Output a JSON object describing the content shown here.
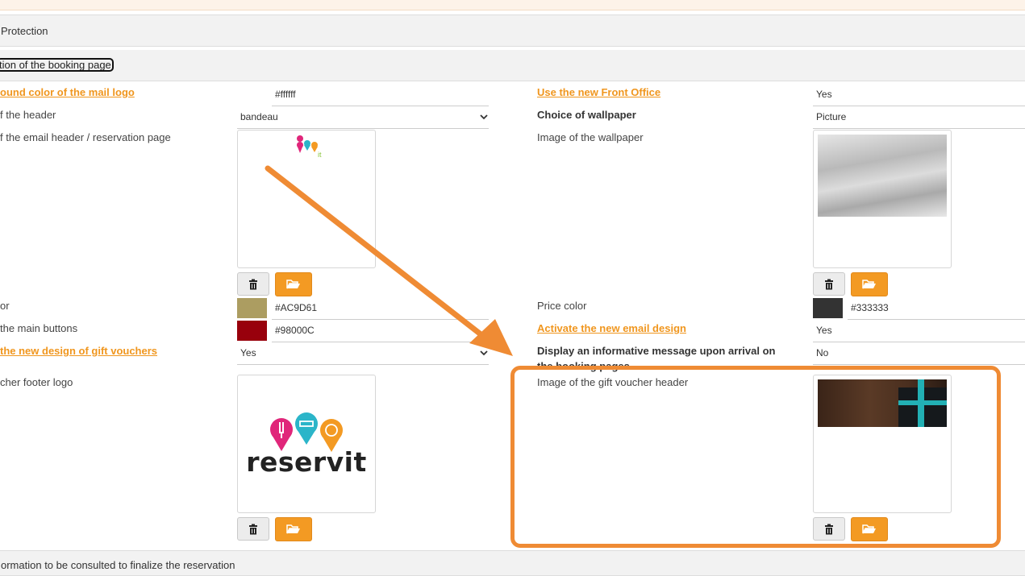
{
  "sections": {
    "protection": "Protection",
    "booking_page": "tion of the booking page",
    "reservation_info": "ormation to be consulted to finalize the reservation"
  },
  "left": {
    "bg_color_label": "ound color of the mail logo",
    "bg_color_value": "#ffffff",
    "header_type_label": "f the header",
    "header_type_value": "bandeau",
    "header_image_label": "f the email header / reservation page",
    "main_color_label": "or",
    "main_color_value": "#AC9D61",
    "buttons_color_label": "the main buttons",
    "buttons_color_value": "#98000C",
    "gift_design_label": " the new design of gift vouchers",
    "gift_design_value": "Yes",
    "footer_logo_label": "cher footer logo"
  },
  "right": {
    "front_office_label": "Use the new Front Office",
    "front_office_value": "Yes",
    "wallpaper_choice_label": "Choice of wallpaper",
    "wallpaper_choice_value": "Picture",
    "wallpaper_image_label": "Image of the wallpaper",
    "price_color_label": "Price color",
    "price_color_value": "#333333",
    "email_design_label": "Activate the new email design",
    "email_design_value": "Yes",
    "arrival_msg_label_1": "Display an informative message upon arrival on",
    "arrival_msg_label_2": "the booking pages",
    "arrival_msg_value": "No",
    "gift_header_label": "Image of the gift voucher header"
  },
  "logo": {
    "text": "reservit"
  },
  "colors": {
    "accent": "#f39a23",
    "link": "#f0961e",
    "main_swatch": "#AC9D61",
    "buttons_swatch": "#98000C",
    "price_swatch": "#333333",
    "annotation": "#ef8b34"
  },
  "icons": {
    "delete": "trash-icon",
    "browse": "folder-open-icon",
    "dropdown": "chevron-down-icon"
  }
}
